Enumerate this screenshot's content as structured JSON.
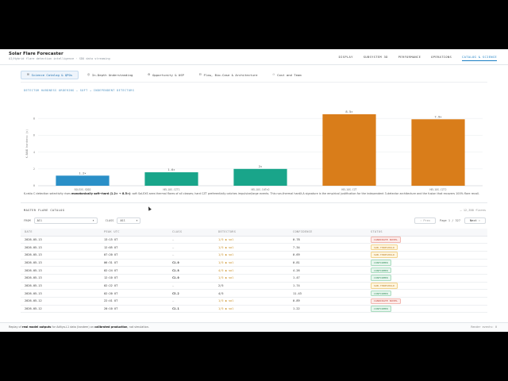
{
  "header": {
    "title": "Solar Flare Forecaster",
    "subtitle": "AI/Hybrid flare detection intelligence · SDO data streaming"
  },
  "nav": [
    "DISPLAY",
    "SUBSYSTEM 3D",
    "PERFORMANCE",
    "OPERATIONS",
    "CATALOG & SCIENCE"
  ],
  "nav_active": 4,
  "subtabs": [
    {
      "icon": "⊞",
      "label": "Science Catalog & QPOs"
    },
    {
      "icon": "◎",
      "label": "In-Depth Understanding"
    },
    {
      "icon": "⚙",
      "label": "Opportunity & USP"
    },
    {
      "icon": "⊟",
      "label": "Flow, Bio-Case & Architecture"
    },
    {
      "icon": "⚇",
      "label": "Cost and Team"
    }
  ],
  "chart": {
    "title": "DETECTOR HARDNESS ORDERING — SOFT → INDEPENDENT DETECTORS",
    "ylabel": "K-BAND hardness (s)"
  },
  "chart_data": {
    "type": "bar",
    "categories": [
      "SOLEXS-SDD2",
      "HEL1OS-CZT1",
      "HEL1OS-CdTe2",
      "HEL1OS-CZT",
      "HEL1OS-CZT2"
    ],
    "values": [
      1.2,
      1.6,
      2.0,
      8.5,
      7.9
    ],
    "data_labels": [
      "1.2×",
      "1.6×",
      "2×",
      "8.5×",
      "7.9×"
    ],
    "colors": [
      "#2a8fc7",
      "#19a58a",
      "#19a58a",
      "#d97d1a",
      "#d97d1a"
    ],
    "yticks": [
      "0",
      "2",
      "4",
      "6",
      "8"
    ],
    "ylim": [
      0,
      10
    ],
    "grid": true
  },
  "caption": {
    "pre": "K-ratio C detection selectivity rises ",
    "bold": "monotonically soft→hard (1.2× → 8.5×)",
    "post": ": soft SoLEXS sees thermal flares of all classes; hard CZT preferentially catches impulsive/large events. This non-thermal hardX-A signature is the empirical justification for the independent 3-detector architecture and the fusion that recovers 100% flare recall."
  },
  "catalog": {
    "title": "MASTER FLARE CATALOG",
    "count": "— 12,358 flares",
    "filter1_label": "FROM",
    "filter1_value": "All",
    "filter2_label": "CLASS",
    "filter2_value": "All",
    "prev": "‹ Prev",
    "page": "Page 1 / 327",
    "next": "Next ›",
    "columns": [
      "DATE",
      "PEAK UTC",
      "CLASS",
      "DETECTORS",
      "CONFIDENCE",
      "STATUS"
    ],
    "rows": [
      [
        "2026-05-13",
        "13:15 UT",
        "—",
        "1/5 ◆ sol",
        "0.78",
        "CANDIDATE NOVEL"
      ],
      [
        "2026-05-13",
        "12:05 UT",
        "—",
        "1/5 ◆ sol",
        "7.34",
        "SUB-THRESHOLD"
      ],
      [
        "2026-05-13",
        "07:20 UT",
        "—",
        "1/5 ◆ sol",
        "0.69",
        "SUB-THRESHOLD"
      ],
      [
        "2026-05-13",
        "06:31 UT",
        "C1.0",
        "1/5 ◆ sol",
        "0.81",
        "CONFIRMED"
      ],
      [
        "2026-05-13",
        "02:24 UT",
        "C1.8",
        "4/5 ◆ sol",
        "4.26",
        "CONFIRMED"
      ],
      [
        "2026-05-13",
        "12:10 UT",
        "C1.0",
        "1/5 ◆ sol",
        "1.47",
        "CONFIRMED"
      ],
      [
        "2026-05-13",
        "02:22 UT",
        "—",
        "2/5",
        "1.74",
        "SUB-THRESHOLD"
      ],
      [
        "2026-05-13",
        "02:20 UT",
        "C3.2",
        "4/5",
        "11.43",
        "CONFIRMED"
      ],
      [
        "2026-05-12",
        "22:41 UT",
        "—",
        "1/5 ◆ sol",
        "0.89",
        "CANDIDATE NOVEL"
      ],
      [
        "2026-05-12",
        "20:10 UT",
        "C1.1",
        "1/5 ◆ sol",
        "1.22",
        "CONFIRMED"
      ]
    ]
  },
  "footer": {
    "pre": "Replay of ",
    "bold1": "real model outputs",
    "mid": " for Aditya-L1 data (tandem) on ",
    "bold2": "calibrated production",
    "post": ", not simulation.",
    "right": "Render events: 0"
  }
}
